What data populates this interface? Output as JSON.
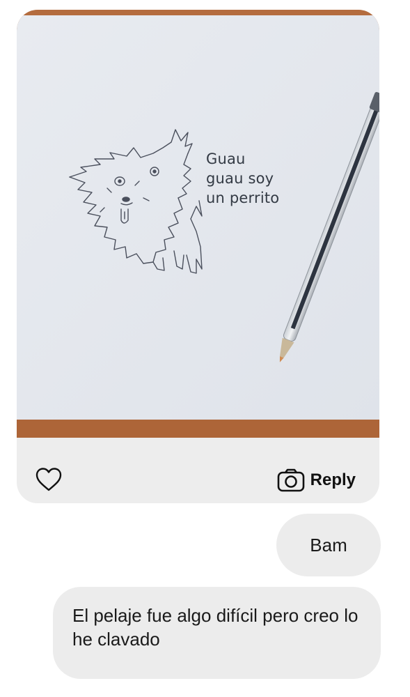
{
  "message_thread": {
    "photo": {
      "handwritten_caption": [
        "Guau",
        "guau soy",
        "un perrito"
      ]
    },
    "actions": {
      "like_icon": "heart-icon",
      "reply_icon": "camera-icon",
      "reply_label": "Reply"
    },
    "messages": [
      {
        "text": "Bam"
      },
      {
        "text": "El pelaje fue algo difícil pero creo lo he clavado"
      }
    ]
  },
  "colors": {
    "bubble": "#ececec",
    "card": "#ededed",
    "table_wood": "#b46c3e",
    "paper": "#e4e8ef"
  }
}
